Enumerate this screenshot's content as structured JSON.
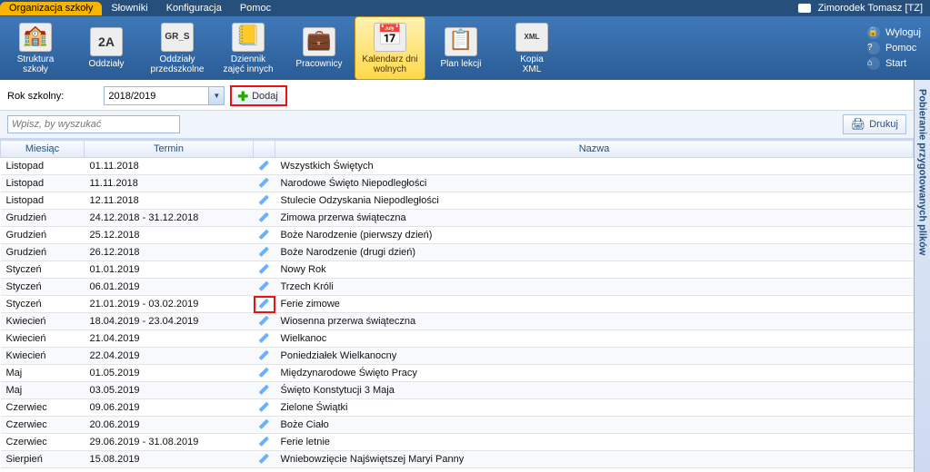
{
  "menubar": {
    "tabs": [
      "Organizacja szkoły",
      "Słowniki",
      "Konfiguracja",
      "Pomoc"
    ],
    "active_index": 0,
    "username": "Zimorodek Tomasz [TZ]"
  },
  "ribbon": {
    "items": [
      {
        "label": "Struktura\nszkoły"
      },
      {
        "label": "Oddziały"
      },
      {
        "label": "Oddziały\nprzedszkolne"
      },
      {
        "label": "Dziennik\nzajęć innych"
      },
      {
        "label": "Pracownicy"
      },
      {
        "label": "Kalendarz dni\nwolnych"
      },
      {
        "label": "Plan lekcji"
      },
      {
        "label": "Kopia\nXML"
      }
    ],
    "active_index": 5,
    "links": [
      "Wyloguj",
      "Pomoc",
      "Start"
    ]
  },
  "toolbar": {
    "year_label": "Rok szkolny:",
    "year_value": "2018/2019",
    "add_label": "Dodaj",
    "search_placeholder": "Wpisz, by wyszukać",
    "print_label": "Drukuj"
  },
  "side_tab": {
    "label": "Pobieranie przygotowanych plików"
  },
  "grid": {
    "headers": {
      "month": "Miesiąc",
      "term": "Termin",
      "name": "Nazwa"
    },
    "rows": [
      {
        "month": "Listopad",
        "term": "01.11.2018",
        "name": "Wszystkich Świętych",
        "hl": false
      },
      {
        "month": "Listopad",
        "term": "11.11.2018",
        "name": "Narodowe Święto Niepodległości",
        "hl": false
      },
      {
        "month": "Listopad",
        "term": "12.11.2018",
        "name": "Stulecie Odzyskania Niepodległości",
        "hl": false
      },
      {
        "month": "Grudzień",
        "term": "24.12.2018 - 31.12.2018",
        "name": "Zimowa przerwa świąteczna",
        "hl": false
      },
      {
        "month": "Grudzień",
        "term": "25.12.2018",
        "name": "Boże Narodzenie (pierwszy dzień)",
        "hl": false
      },
      {
        "month": "Grudzień",
        "term": "26.12.2018",
        "name": "Boże Narodzenie (drugi dzień)",
        "hl": false
      },
      {
        "month": "Styczeń",
        "term": "01.01.2019",
        "name": "Nowy Rok",
        "hl": false
      },
      {
        "month": "Styczeń",
        "term": "06.01.2019",
        "name": "Trzech Króli",
        "hl": false
      },
      {
        "month": "Styczeń",
        "term": "21.01.2019 - 03.02.2019",
        "name": "Ferie zimowe",
        "hl": true
      },
      {
        "month": "Kwiecień",
        "term": "18.04.2019 - 23.04.2019",
        "name": "Wiosenna przerwa świąteczna",
        "hl": false
      },
      {
        "month": "Kwiecień",
        "term": "21.04.2019",
        "name": "Wielkanoc",
        "hl": false
      },
      {
        "month": "Kwiecień",
        "term": "22.04.2019",
        "name": "Poniedziałek Wielkanocny",
        "hl": false
      },
      {
        "month": "Maj",
        "term": "01.05.2019",
        "name": "Międzynarodowe Święto Pracy",
        "hl": false
      },
      {
        "month": "Maj",
        "term": "03.05.2019",
        "name": "Święto Konstytucji 3 Maja",
        "hl": false
      },
      {
        "month": "Czerwiec",
        "term": "09.06.2019",
        "name": "Zielone Świątki",
        "hl": false
      },
      {
        "month": "Czerwiec",
        "term": "20.06.2019",
        "name": "Boże Ciało",
        "hl": false
      },
      {
        "month": "Czerwiec",
        "term": "29.06.2019 - 31.08.2019",
        "name": "Ferie letnie",
        "hl": false
      },
      {
        "month": "Sierpień",
        "term": "15.08.2019",
        "name": "Wniebowzięcie Najświętszej Maryi Panny",
        "hl": false
      }
    ]
  }
}
